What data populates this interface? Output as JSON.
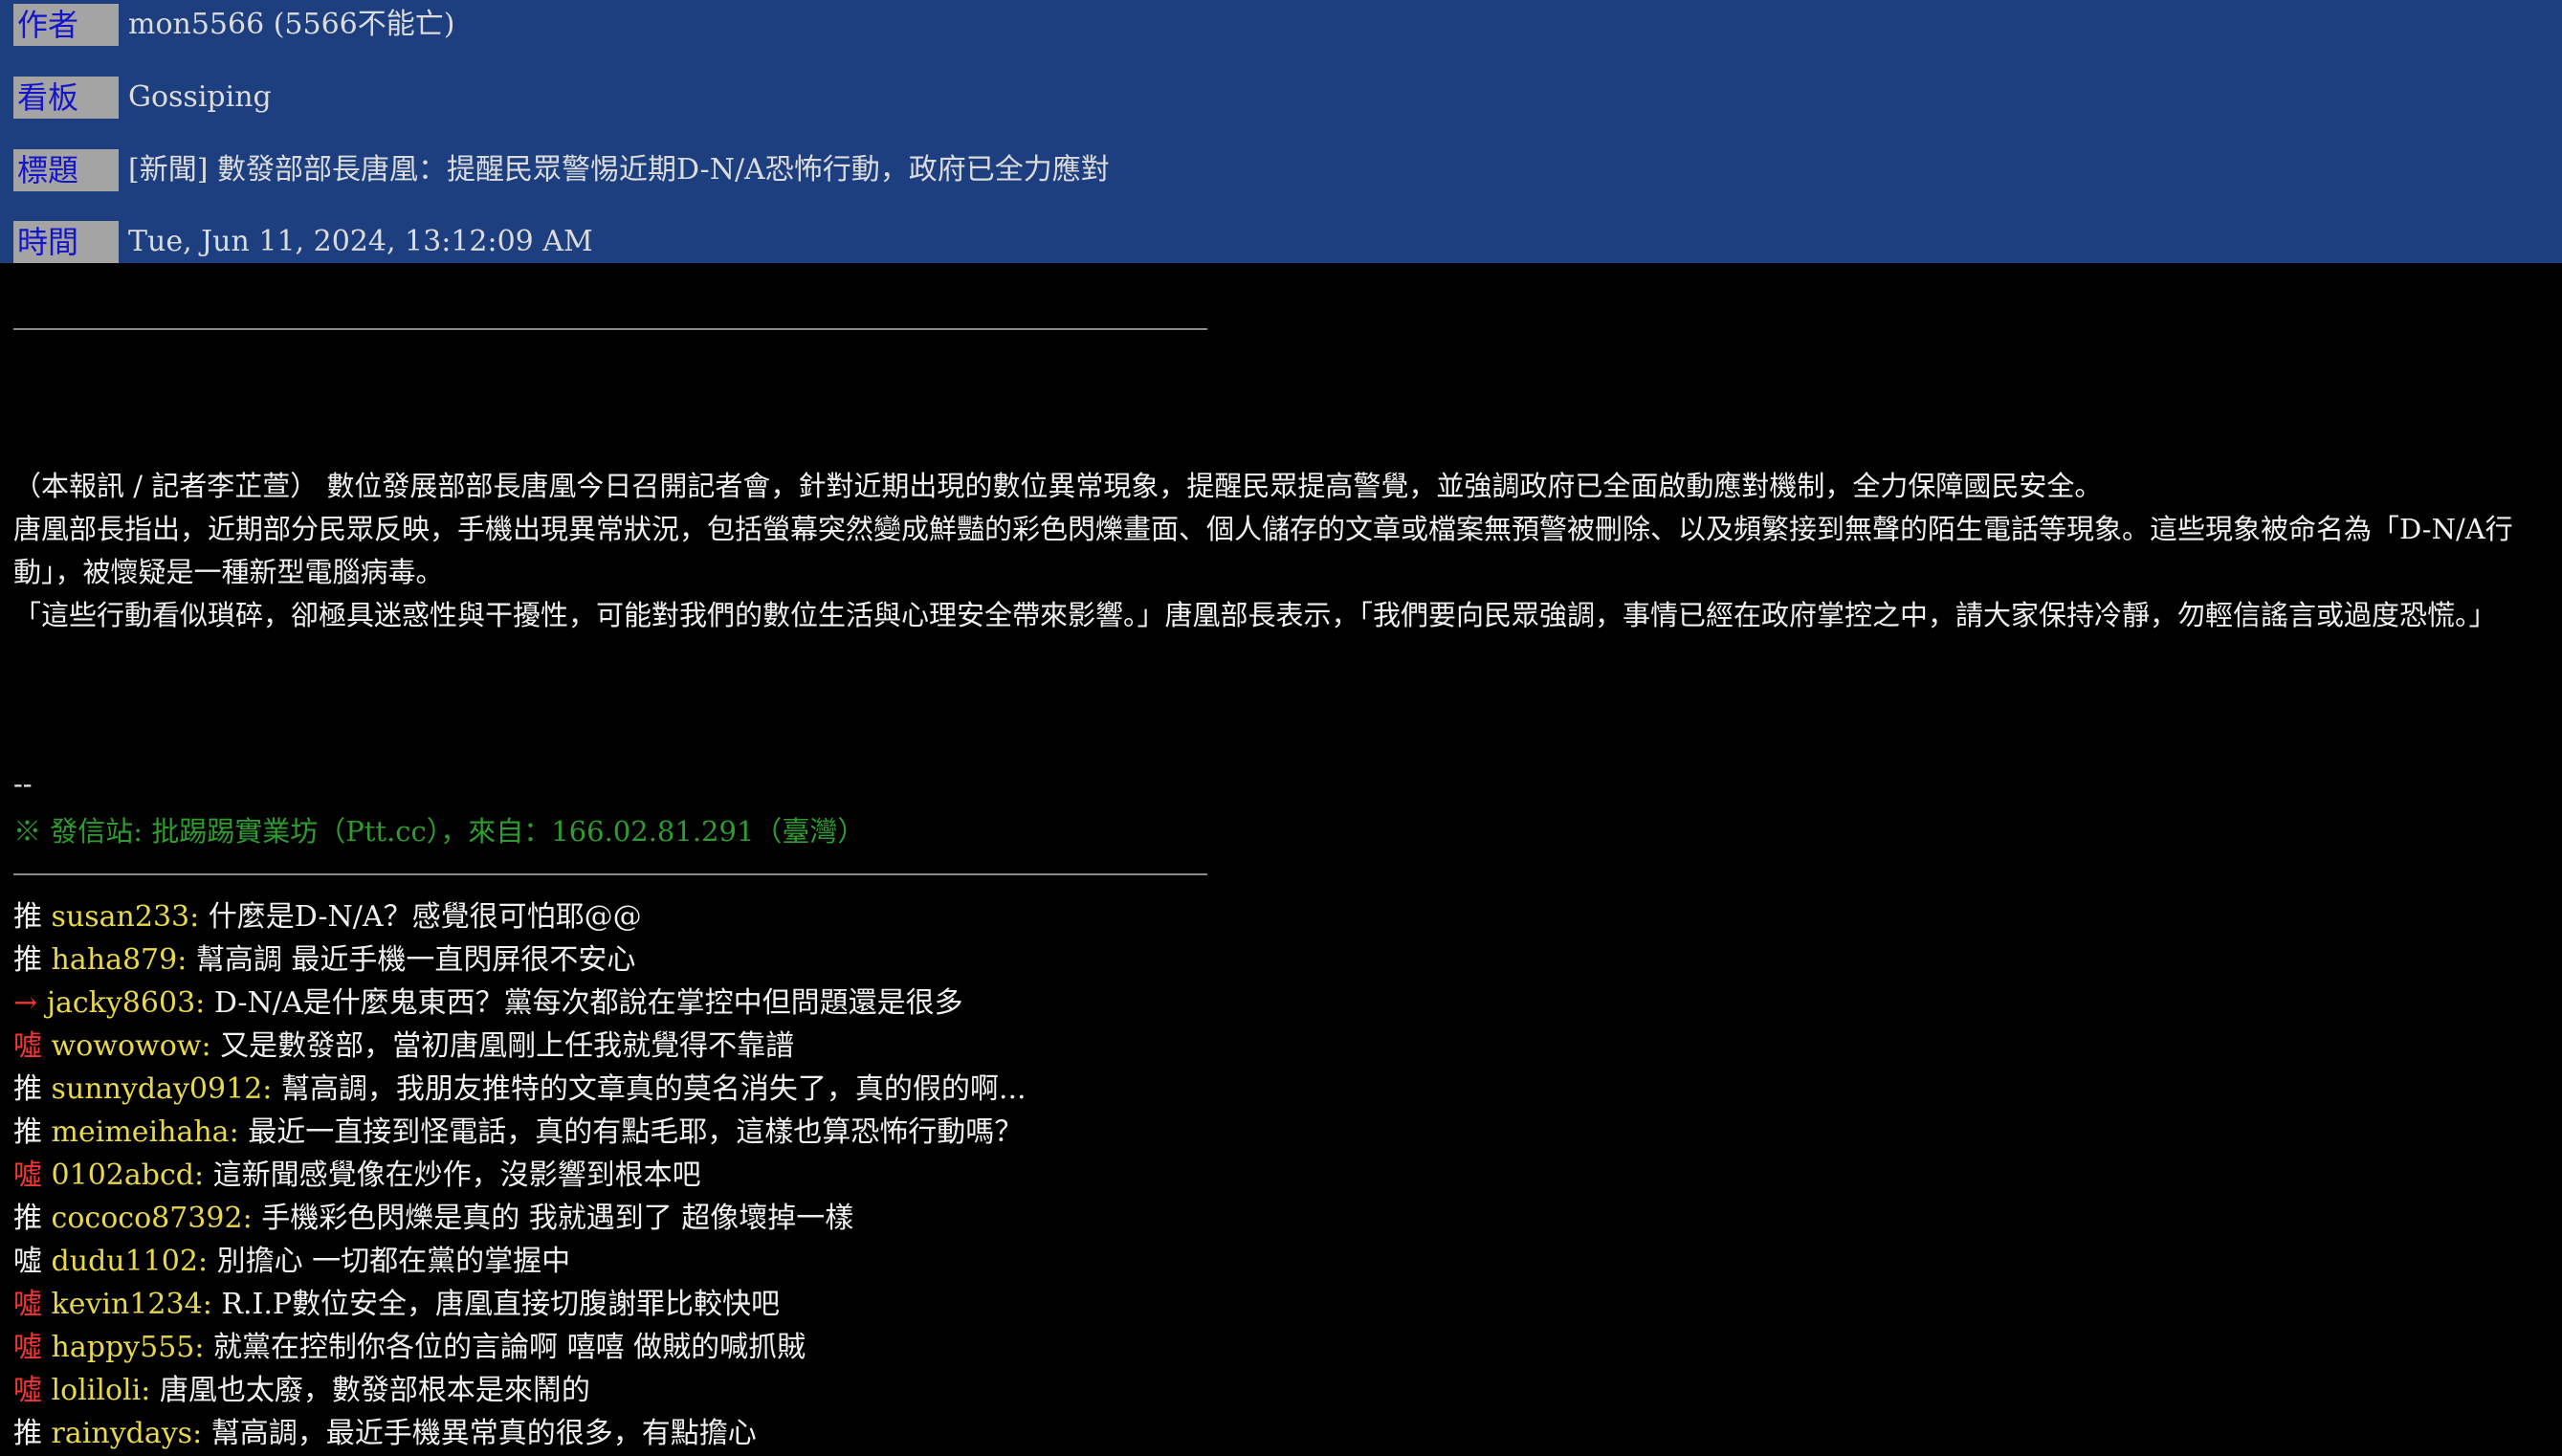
{
  "meta": {
    "author_label": "作者",
    "author_value": "mon5566 (5566不能亡)",
    "board_label": "看板",
    "board_value": "Gossiping",
    "title_label": "標題",
    "title_value": "[新聞] 數發部部長唐凰：提醒民眾警惕近期D-N/A恐怖行動，政府已全力應對",
    "time_label": "時間",
    "time_value": "Tue, Jun 11, 2024, 13:12:09 AM"
  },
  "article": {
    "paragraphs": [
      "（本報訊 / 記者李芷萱） 數位發展部部長唐凰今日召開記者會，針對近期出現的數位異常現象，提醒民眾提高警覺，並強調政府已全面啟動應對機制，全力保障國民安全。",
      "唐凰部長指出，近期部分民眾反映，手機出現異常狀況，包括螢幕突然變成鮮豔的彩色閃爍畫面、個人儲存的文章或檔案無預警被刪除、以及頻繁接到無聲的陌生電話等現象。這些現象被命名為「D-N/A行動」，被懷疑是一種新型電腦病毒。",
      "「這些行動看似瑣碎，卻極具迷惑性與干擾性，可能對我們的數位生活與心理安全帶來影響。」唐凰部長表示，「我們要向民眾強調，事情已經在政府掌控之中，請大家保持冷靜，勿輕信謠言或過度恐慌。」"
    ]
  },
  "signature": {
    "dashes": "--",
    "source": "※ 發信站: 批踢踢實業坊（Ptt.cc），來自：166.02.81.291（臺灣）"
  },
  "comments": [
    {
      "tag": "推",
      "type": "push",
      "user": "susan233",
      "text": "什麼是D-N/A？感覺很可怕耶@@"
    },
    {
      "tag": "推",
      "type": "push",
      "user": "haha879",
      "text": "幫高調 最近手機一直閃屏很不安心"
    },
    {
      "tag": "→",
      "type": "arrow",
      "user": "jacky8603",
      "text": "D-N/A是什麼鬼東西？黨每次都說在掌控中但問題還是很多"
    },
    {
      "tag": "噓",
      "type": "boo",
      "user": "wowowow",
      "text": "又是數發部，當初唐凰剛上任我就覺得不靠譜"
    },
    {
      "tag": "推",
      "type": "push",
      "user": "sunnyday0912",
      "text": "幫高調，我朋友推特的文章真的莫名消失了，真的假的啊..."
    },
    {
      "tag": "推",
      "type": "push",
      "user": "meimeihaha",
      "text": "最近一直接到怪電話，真的有點毛耶，這樣也算恐怖行動嗎？"
    },
    {
      "tag": "噓",
      "type": "boo",
      "user": "0102abcd",
      "text": "這新聞感覺像在炒作，沒影響到根本吧"
    },
    {
      "tag": "推",
      "type": "push",
      "user": "cococo87392",
      "text": "手機彩色閃爍是真的 我就遇到了 超像壞掉一樣"
    },
    {
      "tag": "噓",
      "type": "neutral",
      "user": "dudu1102",
      "text": "別擔心 一切都在黨的掌握中"
    },
    {
      "tag": "噓",
      "type": "boo",
      "user": "kevin1234",
      "text": "R.I.P數位安全，唐凰直接切腹謝罪比較快吧"
    },
    {
      "tag": "噓",
      "type": "boo",
      "user": "happy555",
      "text": "就黨在控制你各位的言論啊 嘻嘻 做賊的喊抓賊"
    },
    {
      "tag": "噓",
      "type": "boo",
      "user": "loliloli",
      "text": "唐凰也太廢，數發部根本是來鬧的"
    },
    {
      "tag": "推",
      "type": "push",
      "user": "rainydays",
      "text": "幫高調，最近手機異常真的很多，有點擔心"
    }
  ]
}
